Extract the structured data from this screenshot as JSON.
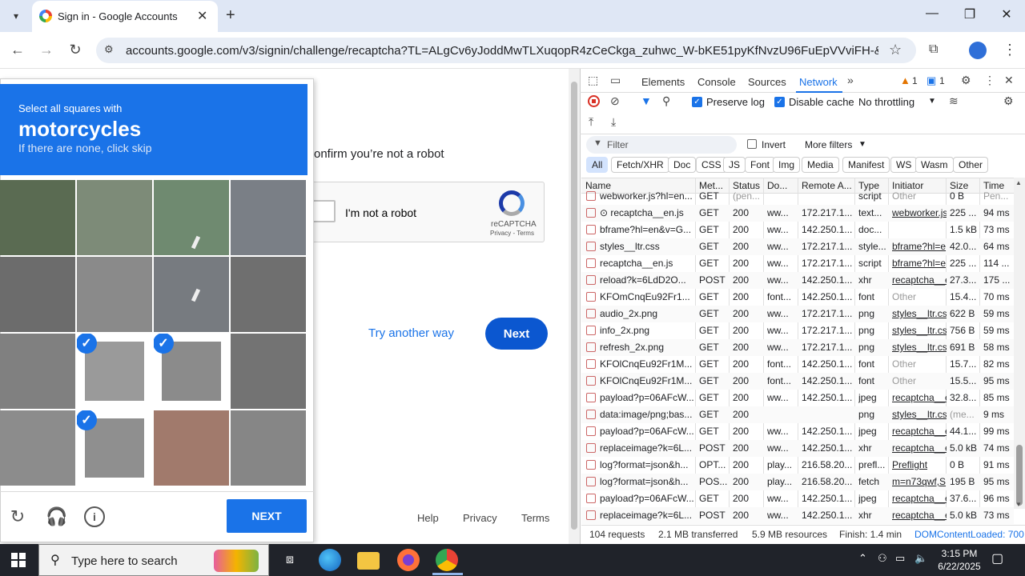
{
  "browser": {
    "tab_title": "Sign in - Google Accounts",
    "url": "accounts.google.com/v3/signin/challenge/recaptcha?TL=ALgCv6yJoddMwTLXuqopR4zCeCkga_zuhwc_W-bKE51pyKfNvzU96FuEpVVviFH-&checkConn..."
  },
  "google_page": {
    "prompt": "onfirm you’re not a robot",
    "checkbox_label": "I'm not a robot",
    "recaptcha_name": "reCAPTCHA",
    "recaptcha_links": "Privacy - Terms",
    "try_another": "Try another way",
    "next": "Next",
    "footer": {
      "help": "Help",
      "privacy": "Privacy",
      "terms": "Terms"
    }
  },
  "challenge": {
    "line1": "Select all squares with",
    "line2": "motorcycles",
    "line3": "If there are none, click skip",
    "selected_tiles": [
      9,
      10,
      13
    ],
    "verify": "NEXT"
  },
  "devtools": {
    "tabs": [
      "Elements",
      "Console",
      "Sources",
      "Network"
    ],
    "warnings": "1",
    "messages": "1",
    "preserve_log": "Preserve log",
    "disable_cache": "Disable cache",
    "throttling": "No throttling",
    "filter_placeholder": "Filter",
    "invert": "Invert",
    "more_filters": "More filters",
    "chips": [
      "All",
      "Fetch/XHR",
      "Doc",
      "CSS",
      "JS",
      "Font",
      "Img",
      "Media",
      "Manifest",
      "WS",
      "Wasm",
      "Other"
    ],
    "columns": [
      "Name",
      "Met...",
      "Status",
      "Do...",
      "Remote A...",
      "Type",
      "Initiator",
      "Size",
      "Time"
    ],
    "rows": [
      {
        "name": "webworker.js?hl=en...",
        "method": "GET",
        "status": "(pen...",
        "domain": "",
        "remote": "",
        "type": "script",
        "initiator": "Other",
        "size": "0 B",
        "time": "Pen..."
      },
      {
        "name": "⊙ recaptcha__en.js",
        "method": "GET",
        "status": "200",
        "domain": "ww...",
        "remote": "172.217.1...",
        "type": "text...",
        "initiator": "webworker.js",
        "size": "225 ...",
        "time": "94 ms"
      },
      {
        "name": "bframe?hl=en&v=G...",
        "method": "GET",
        "status": "200",
        "domain": "ww...",
        "remote": "142.250.1...",
        "type": "doc...",
        "initiator": "",
        "size": "1.5 kB",
        "time": "73 ms"
      },
      {
        "name": "styles__ltr.css",
        "method": "GET",
        "status": "200",
        "domain": "ww...",
        "remote": "172.217.1...",
        "type": "style...",
        "initiator": "bframe?hl=e",
        "size": "42.0...",
        "time": "64 ms"
      },
      {
        "name": "recaptcha__en.js",
        "method": "GET",
        "status": "200",
        "domain": "ww...",
        "remote": "172.217.1...",
        "type": "script",
        "initiator": "bframe?hl=e",
        "size": "225 ...",
        "time": "114 ..."
      },
      {
        "name": "reload?k=6LdD2O...",
        "method": "POST",
        "status": "200",
        "domain": "ww...",
        "remote": "142.250.1...",
        "type": "xhr",
        "initiator": "recaptcha__e",
        "size": "27.3...",
        "time": "175 ..."
      },
      {
        "name": "KFOmCnqEu92Fr1...",
        "method": "GET",
        "status": "200",
        "domain": "font...",
        "remote": "142.250.1...",
        "type": "font",
        "initiator": "Other",
        "size": "15.4...",
        "time": "70 ms"
      },
      {
        "name": "audio_2x.png",
        "method": "GET",
        "status": "200",
        "domain": "ww...",
        "remote": "172.217.1...",
        "type": "png",
        "initiator": "styles__ltr.css",
        "size": "622 B",
        "time": "59 ms"
      },
      {
        "name": "info_2x.png",
        "method": "GET",
        "status": "200",
        "domain": "ww...",
        "remote": "172.217.1...",
        "type": "png",
        "initiator": "styles__ltr.css",
        "size": "756 B",
        "time": "59 ms"
      },
      {
        "name": "refresh_2x.png",
        "method": "GET",
        "status": "200",
        "domain": "ww...",
        "remote": "172.217.1...",
        "type": "png",
        "initiator": "styles__ltr.css",
        "size": "691 B",
        "time": "58 ms"
      },
      {
        "name": "KFOlCnqEu92Fr1M...",
        "method": "GET",
        "status": "200",
        "domain": "font...",
        "remote": "142.250.1...",
        "type": "font",
        "initiator": "Other",
        "size": "15.7...",
        "time": "82 ms"
      },
      {
        "name": "KFOlCnqEu92Fr1M...",
        "method": "GET",
        "status": "200",
        "domain": "font...",
        "remote": "142.250.1...",
        "type": "font",
        "initiator": "Other",
        "size": "15.5...",
        "time": "95 ms"
      },
      {
        "name": "payload?p=06AFcW...",
        "method": "GET",
        "status": "200",
        "domain": "ww...",
        "remote": "142.250.1...",
        "type": "jpeg",
        "initiator": "recaptcha__e",
        "size": "32.8...",
        "time": "85 ms"
      },
      {
        "name": "data:image/png;bas...",
        "method": "GET",
        "status": "200",
        "domain": "",
        "remote": "",
        "type": "png",
        "initiator": "styles__ltr.css",
        "size": "(me...",
        "time": "9 ms"
      },
      {
        "name": "payload?p=06AFcW...",
        "method": "GET",
        "status": "200",
        "domain": "ww...",
        "remote": "142.250.1...",
        "type": "jpeg",
        "initiator": "recaptcha__e",
        "size": "44.1...",
        "time": "99 ms"
      },
      {
        "name": "replaceimage?k=6L...",
        "method": "POST",
        "status": "200",
        "domain": "ww...",
        "remote": "142.250.1...",
        "type": "xhr",
        "initiator": "recaptcha__e",
        "size": "5.0 kB",
        "time": "74 ms"
      },
      {
        "name": "log?format=json&h...",
        "method": "OPT...",
        "status": "200",
        "domain": "play...",
        "remote": "216.58.20...",
        "type": "prefl...",
        "initiator": "Preflight",
        "size": "0 B",
        "time": "91 ms"
      },
      {
        "name": "log?format=json&h...",
        "method": "POS...",
        "status": "200",
        "domain": "play...",
        "remote": "216.58.20...",
        "type": "fetch",
        "initiator": "m=n73qwf,S",
        "size": "195 B",
        "time": "95 ms"
      },
      {
        "name": "payload?p=06AFcW...",
        "method": "GET",
        "status": "200",
        "domain": "ww...",
        "remote": "142.250.1...",
        "type": "jpeg",
        "initiator": "recaptcha__e",
        "size": "37.6...",
        "time": "96 ms"
      },
      {
        "name": "replaceimage?k=6L...",
        "method": "POST",
        "status": "200",
        "domain": "ww...",
        "remote": "142.250.1...",
        "type": "xhr",
        "initiator": "recaptcha__e",
        "size": "5.0 kB",
        "time": "73 ms"
      }
    ],
    "status_bar": {
      "requests": "104 requests",
      "transferred": "2.1 MB transferred",
      "resources": "5.9 MB resources",
      "finish": "Finish: 1.4 min",
      "dcl": "DOMContentLoaded: 700"
    }
  },
  "taskbar": {
    "search_placeholder": "Type here to search",
    "time": "3:15 PM",
    "date": "6/22/2025"
  }
}
